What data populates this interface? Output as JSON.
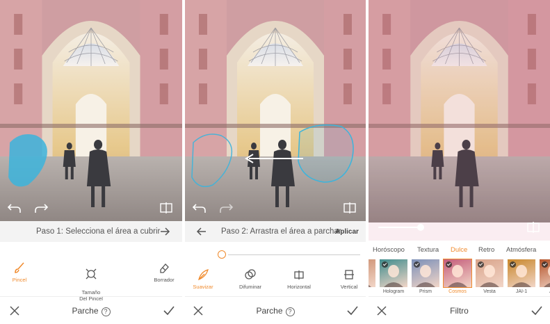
{
  "panel1": {
    "step_text": "Paso 1: Selecciona el área a cubrir",
    "tools": [
      {
        "label": "Pincel",
        "icon": "brush-icon",
        "active": true
      },
      {
        "label": "Tamaño\nDel Pincel",
        "icon": "brush-size-icon",
        "active": false
      },
      {
        "label": "Borrador",
        "icon": "eraser-icon",
        "active": false
      }
    ],
    "title": "Parche",
    "help": "?"
  },
  "panel2": {
    "step_text": "Paso 2: Arrastra el área a parchar",
    "apply_label": "Aplicar",
    "tools": [
      {
        "label": "Suavizar",
        "icon": "feather-icon",
        "active": true
      },
      {
        "label": "Difuminar",
        "icon": "blend-circles-icon",
        "active": false
      },
      {
        "label": "Horizontal",
        "icon": "flip-horizontal-icon",
        "active": false
      },
      {
        "label": "Vertical",
        "icon": "flip-vertical-icon",
        "active": false
      }
    ],
    "title": "Parche",
    "help": "?"
  },
  "panel3": {
    "tabs": [
      {
        "label": "Horóscopo",
        "active": false
      },
      {
        "label": "Textura",
        "active": false
      },
      {
        "label": "Dulce",
        "active": true
      },
      {
        "label": "Retro",
        "active": false
      },
      {
        "label": "Atmósfera",
        "active": false
      }
    ],
    "thumbs": [
      {
        "label": "a",
        "active": false,
        "bg": "#c98a6a"
      },
      {
        "label": "Hologram",
        "active": false,
        "bg": "#3f8c8c"
      },
      {
        "label": "Prism",
        "active": false,
        "bg": "#7b8fb8"
      },
      {
        "label": "Cosmos",
        "active": true,
        "bg": "#c45c7a"
      },
      {
        "label": "Vesta",
        "active": false,
        "bg": "#d9a38a"
      },
      {
        "label": "JAI-1",
        "active": false,
        "bg": "#c8862a"
      },
      {
        "label": "JAI-",
        "active": false,
        "bg": "#b5542a"
      }
    ],
    "title": "Filtro"
  },
  "colors": {
    "accent": "#f08a2c",
    "patch": "#3cb4dc"
  }
}
